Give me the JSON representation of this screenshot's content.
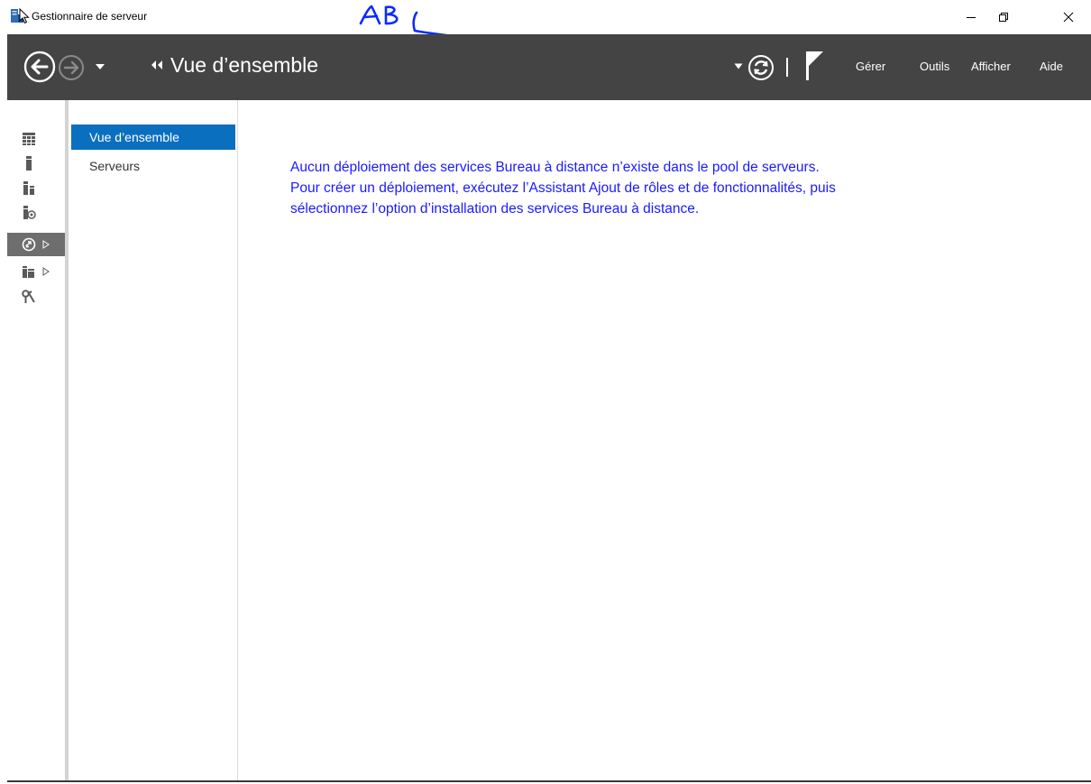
{
  "window": {
    "title": "Gestionnaire de serveur",
    "annotation": "ABL",
    "controls": [
      "minimize",
      "restore",
      "close"
    ]
  },
  "toolbar": {
    "breadcrumb_title": "Vue d’ensemble",
    "menus": {
      "manage": "Gérer",
      "tools": "Outils",
      "view": "Afficher",
      "help": "Aide"
    },
    "icons": [
      "back-arrow-icon",
      "forward-arrow-icon",
      "history-dropdown-icon",
      "breadcrumb-arrows-icon",
      "dropdown-icon",
      "refresh-icon",
      "notification-flag-icon"
    ]
  },
  "rail": {
    "items": [
      {
        "icon": "dashboard-icon",
        "selected": false,
        "expandable": false
      },
      {
        "icon": "local-server-icon",
        "selected": false,
        "expandable": false
      },
      {
        "icon": "all-servers-icon",
        "selected": false,
        "expandable": false
      },
      {
        "icon": "server-role-icon",
        "selected": false,
        "expandable": false
      },
      {
        "icon": "remote-desktop-services-icon",
        "selected": true,
        "expandable": true
      },
      {
        "icon": "file-storage-services-icon",
        "selected": false,
        "expandable": true
      },
      {
        "icon": "tools-icon",
        "selected": false,
        "expandable": false
      }
    ]
  },
  "nav": {
    "items": [
      {
        "label": "Vue d’ensemble",
        "selected": true
      },
      {
        "label": "Serveurs",
        "selected": false
      }
    ]
  },
  "content": {
    "message_lines": [
      "Aucun déploiement des services Bureau à distance n’existe dans le pool de serveurs.",
      "Pour créer un déploiement, exécutez l’Assistant Ajout de rôles et de fonctionnalités, puis",
      "sélectionnez l’option d’installation des services Bureau à distance."
    ]
  },
  "colors": {
    "toolbar_bg": "#444444",
    "nav_selected_bg": "#0b6fbf",
    "rail_selected_bg": "#6e6e6e",
    "message_text": "#1a1aff",
    "annotation_ink": "#0a2cff"
  }
}
